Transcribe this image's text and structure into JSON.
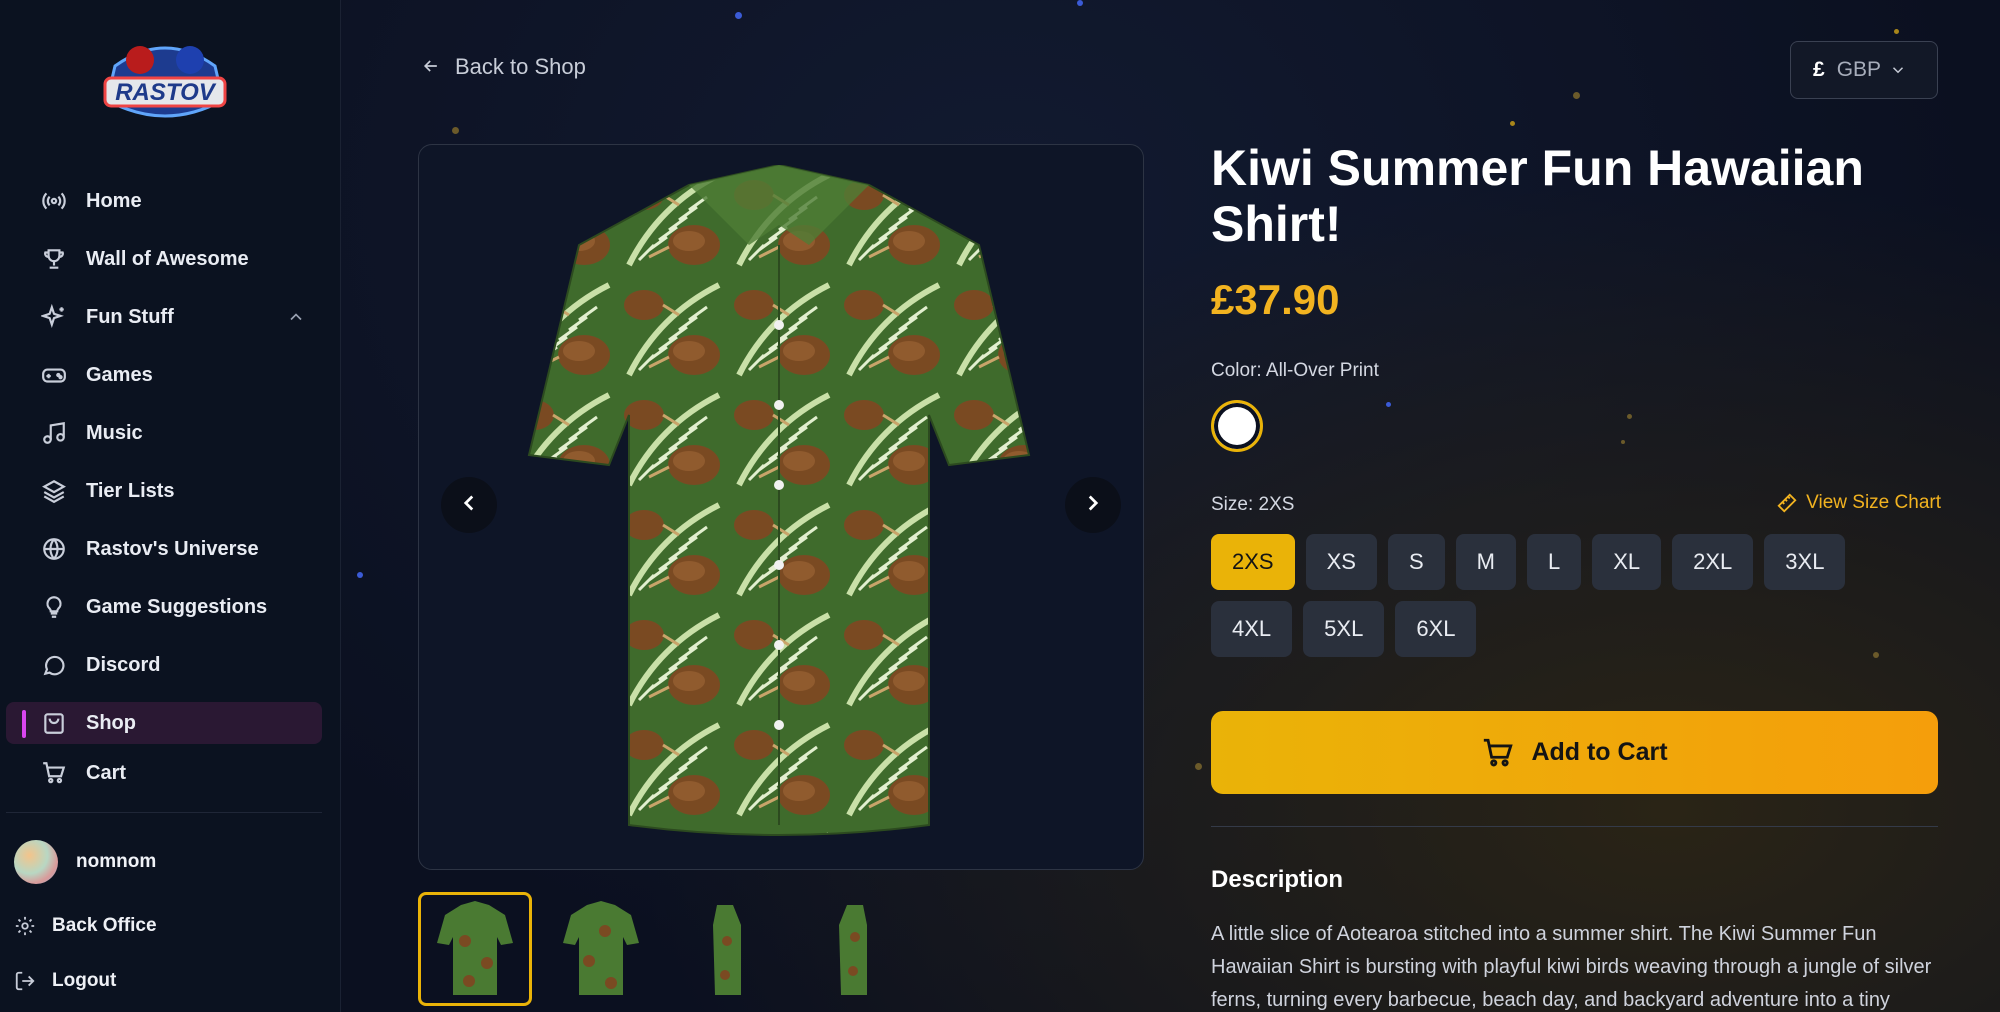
{
  "brand": {
    "logo_text": "RASTOV"
  },
  "sidebar": {
    "items": [
      {
        "label": "Home",
        "icon": "radio-icon"
      },
      {
        "label": "Wall of Awesome",
        "icon": "trophy-icon"
      },
      {
        "label": "Fun Stuff",
        "icon": "sparkles-icon",
        "expanded": true
      },
      {
        "label": "Games",
        "icon": "gamepad-icon"
      },
      {
        "label": "Music",
        "icon": "music-icon"
      },
      {
        "label": "Tier Lists",
        "icon": "layers-icon"
      },
      {
        "label": "Rastov's Universe",
        "icon": "globe-icon"
      },
      {
        "label": "Game Suggestions",
        "icon": "lightbulb-icon"
      },
      {
        "label": "Discord",
        "icon": "chat-icon"
      },
      {
        "label": "Shop",
        "icon": "shopping-bag-icon",
        "active": true
      },
      {
        "label": "Cart",
        "icon": "cart-icon"
      }
    ],
    "user": {
      "name": "nomnom"
    },
    "back_office": "Back Office",
    "logout": "Logout"
  },
  "header": {
    "back_label": "Back to Shop",
    "currency": {
      "symbol": "£",
      "code": "GBP"
    }
  },
  "product": {
    "title": "Kiwi Summer Fun Hawaiian Shirt!",
    "price": "£37.90",
    "color_label": "Color: All-Over Print",
    "size_label": "Size: 2XS",
    "size_chart_label": "View Size Chart",
    "sizes": [
      "2XS",
      "XS",
      "S",
      "M",
      "L",
      "XL",
      "2XL",
      "3XL",
      "4XL",
      "5XL",
      "6XL"
    ],
    "selected_size": "2XS",
    "add_to_cart": "Add to Cart",
    "description_title": "Description",
    "description": "A little slice of Aotearoa stitched into a summer shirt. The Kiwi Summer Fun Hawaiian Shirt is bursting with playful kiwi birds weaving through a jungle of silver ferns, turning every barbecue, beach day, and backyard adventure into a tiny",
    "thumbnail_count": 4,
    "selected_thumbnail": 0
  },
  "colors": {
    "accent": "#eab308",
    "active_nav": "#2a1833",
    "active_bar": "#d946ef",
    "background": "#0b1020"
  }
}
